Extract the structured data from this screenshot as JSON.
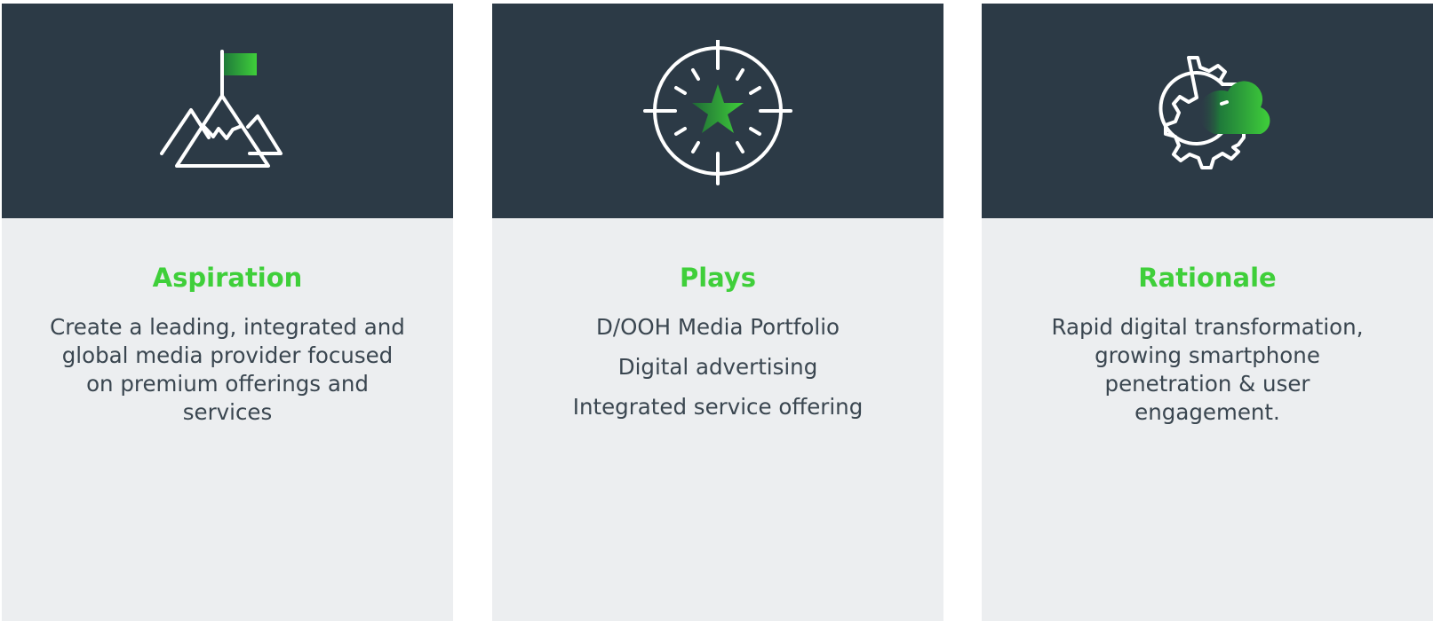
{
  "colors": {
    "header_bg": "#2c3a46",
    "card_bg": "#eceef0",
    "title_green": "#3fcf3a",
    "text": "#3a4650",
    "icon_stroke": "#ffffff",
    "icon_green_dark": "#1f7a3a",
    "icon_green_light": "#3fcf3a"
  },
  "cards": [
    {
      "icon": "mountain-flag-icon",
      "title": "Aspiration",
      "body": "Create a leading, integrated and global media provider focused on premium offerings and services"
    },
    {
      "icon": "target-star-icon",
      "title": "Plays",
      "items": [
        "D/OOH Media Portfolio",
        "Digital advertising",
        "Integrated service offering"
      ]
    },
    {
      "icon": "gear-cloud-icon",
      "title": "Rationale",
      "body": "Rapid digital transformation, growing smartphone penetration & user engagement."
    }
  ]
}
